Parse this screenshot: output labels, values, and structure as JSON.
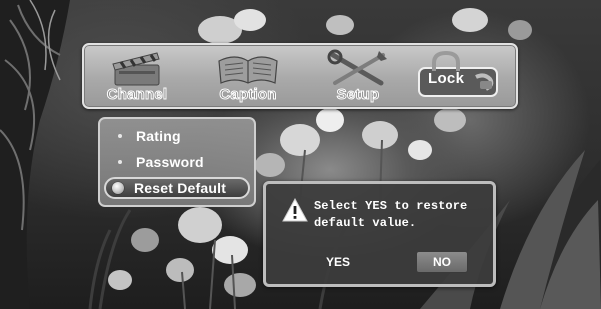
{
  "menu": {
    "items": [
      {
        "label": "Channel",
        "icon": "clapperboard-icon",
        "selected": false
      },
      {
        "label": "Caption",
        "icon": "open-book-icon",
        "selected": false
      },
      {
        "label": "Setup",
        "icon": "tools-icon",
        "selected": false
      },
      {
        "label": "Lock",
        "icon": "padlock-icon",
        "selected": true
      }
    ]
  },
  "submenu": {
    "items": [
      {
        "label": "Rating",
        "selected": false
      },
      {
        "label": "Password",
        "selected": false
      },
      {
        "label": "Reset Default",
        "selected": true
      }
    ]
  },
  "dialog": {
    "icon": "warning-icon",
    "line1": "Select YES to restore",
    "line2": "default value.",
    "yes_label": "YES",
    "no_label": "NO",
    "focused_button": "NO"
  },
  "colors": {
    "panel": "#a9a9a9",
    "highlight": "#3e3e3e",
    "text": "#ffffff"
  }
}
